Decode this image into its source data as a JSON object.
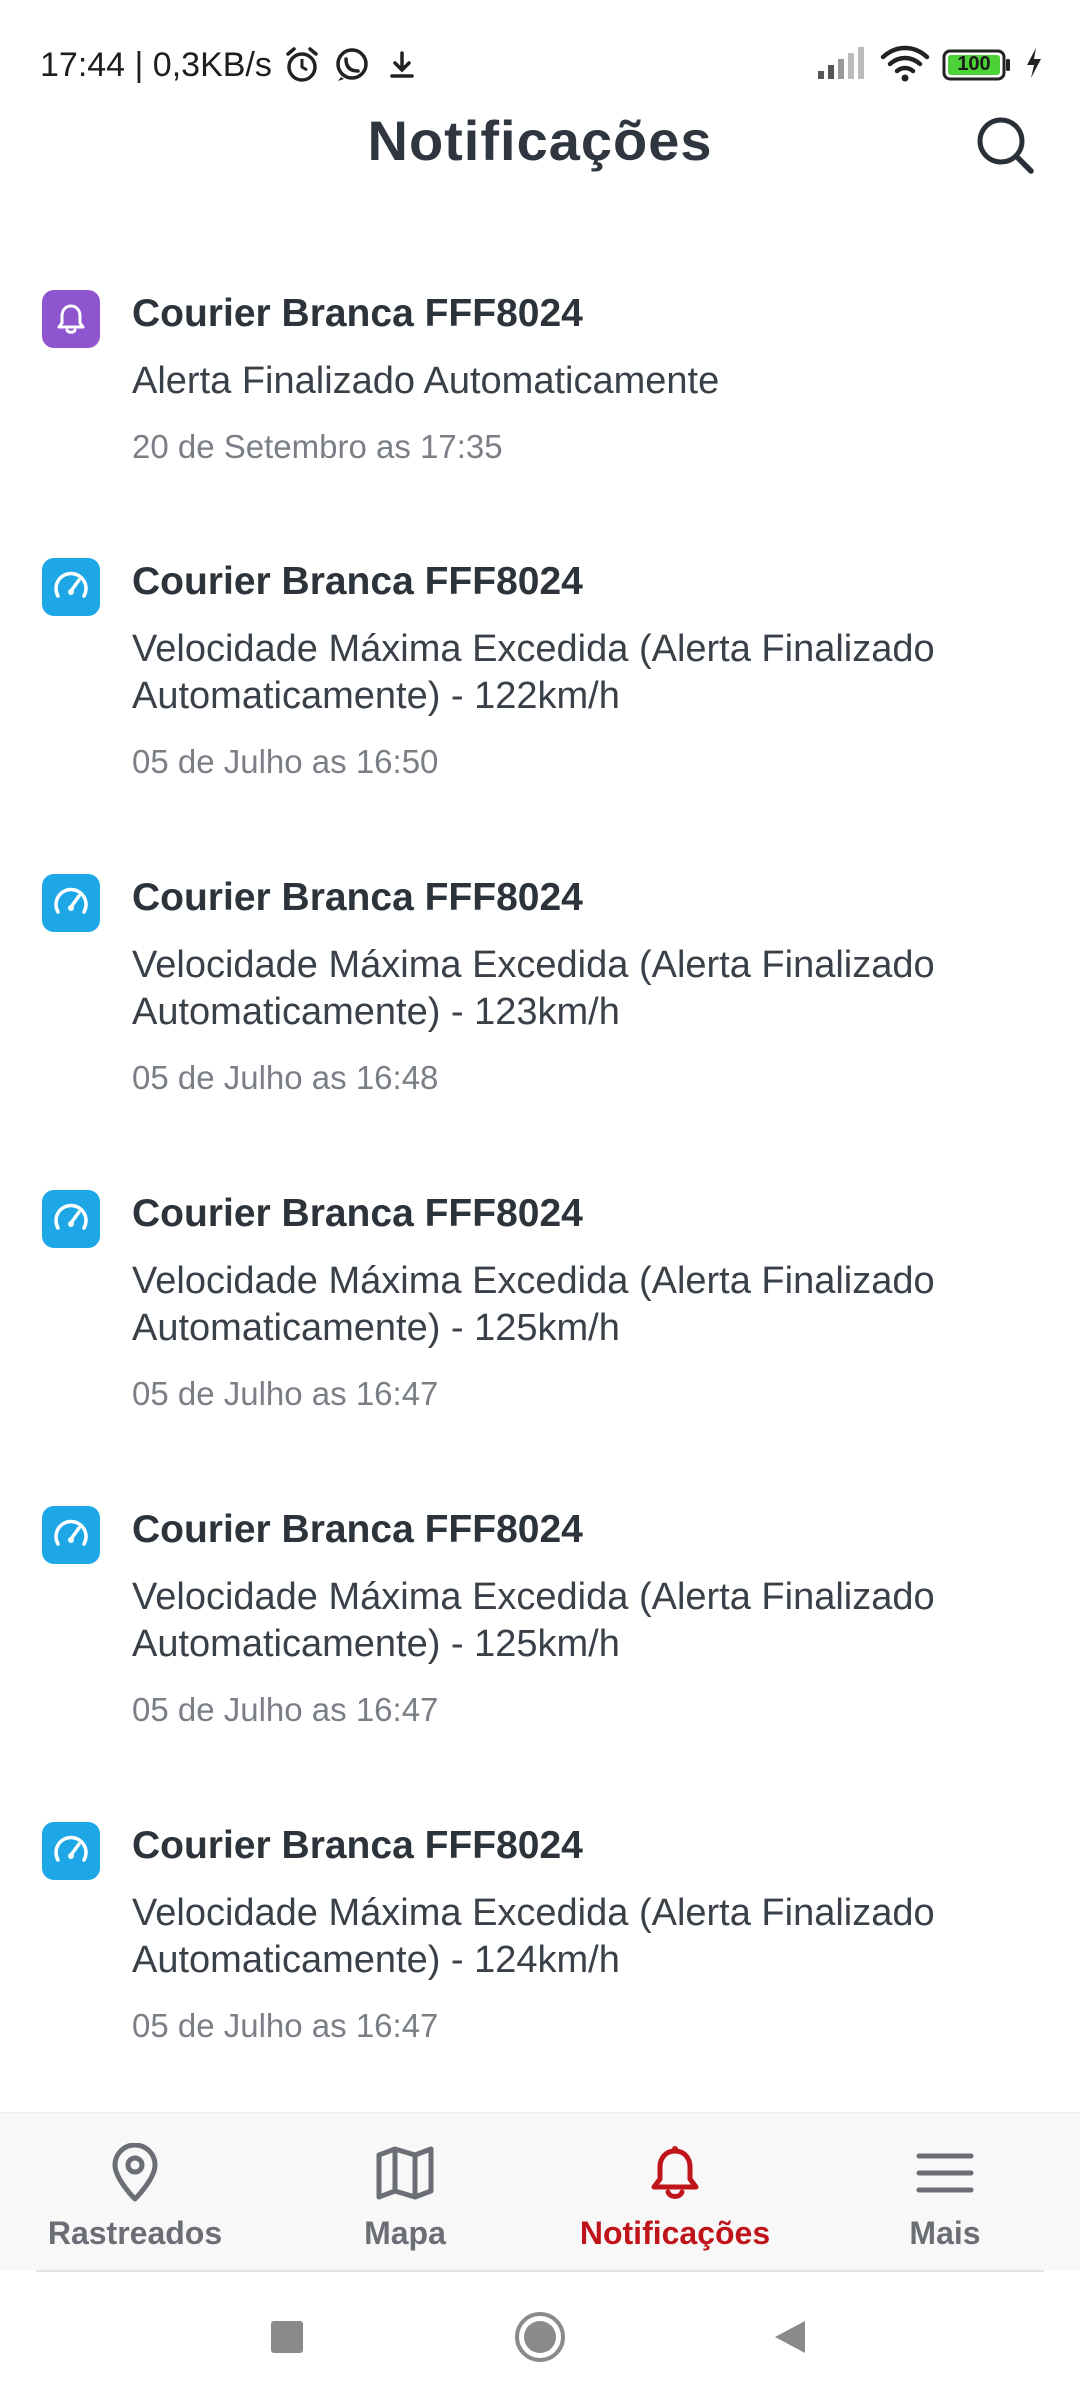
{
  "status_bar": {
    "time_speed": "17:44 | 0,3KB/s",
    "battery": "100",
    "icons": [
      "alarm-icon",
      "whatsapp-icon",
      "download-icon",
      "signal-icon",
      "wifi-icon",
      "battery-icon",
      "charging-icon"
    ]
  },
  "header": {
    "title": "Notificações",
    "search_icon": "search-icon"
  },
  "notifications": [
    {
      "icon": "bell-icon",
      "icon_color": "#8e55cf",
      "title": "Courier Branca FFF8024",
      "body": "Alerta Finalizado Automaticamente",
      "time": "20 de Setembro as 17:35"
    },
    {
      "icon": "speedometer-icon",
      "icon_color": "#1ea7e6",
      "title": "Courier Branca FFF8024",
      "body": "Velocidade Máxima Excedida (Alerta Finalizado Automaticamente) - 122km/h",
      "time": "05 de Julho as 16:50"
    },
    {
      "icon": "speedometer-icon",
      "icon_color": "#1ea7e6",
      "title": "Courier Branca FFF8024",
      "body": "Velocidade Máxima Excedida (Alerta Finalizado Automaticamente) - 123km/h",
      "time": "05 de Julho as 16:48"
    },
    {
      "icon": "speedometer-icon",
      "icon_color": "#1ea7e6",
      "title": "Courier Branca FFF8024",
      "body": "Velocidade Máxima Excedida (Alerta Finalizado Automaticamente) - 125km/h",
      "time": "05 de Julho as 16:47"
    },
    {
      "icon": "speedometer-icon",
      "icon_color": "#1ea7e6",
      "title": "Courier Branca FFF8024",
      "body": "Velocidade Máxima Excedida (Alerta Finalizado Automaticamente) - 125km/h",
      "time": "05 de Julho as 16:47"
    },
    {
      "icon": "speedometer-icon",
      "icon_color": "#1ea7e6",
      "title": "Courier Branca FFF8024",
      "body": "Velocidade Máxima Excedida (Alerta Finalizado Automaticamente) - 124km/h",
      "time": "05 de Julho as 16:47"
    }
  ],
  "bottom_nav": {
    "items": [
      {
        "label": "Rastreados",
        "icon": "location-pin-icon",
        "active": false
      },
      {
        "label": "Mapa",
        "icon": "map-icon",
        "active": false
      },
      {
        "label": "Notificações",
        "icon": "bell-icon",
        "active": true
      },
      {
        "label": "Mais",
        "icon": "menu-icon",
        "active": false
      }
    ],
    "active_color": "#c0141b",
    "inactive_color": "#6b6f75"
  },
  "system_nav": {
    "icons": [
      "recents-icon",
      "home-icon",
      "back-icon"
    ]
  }
}
